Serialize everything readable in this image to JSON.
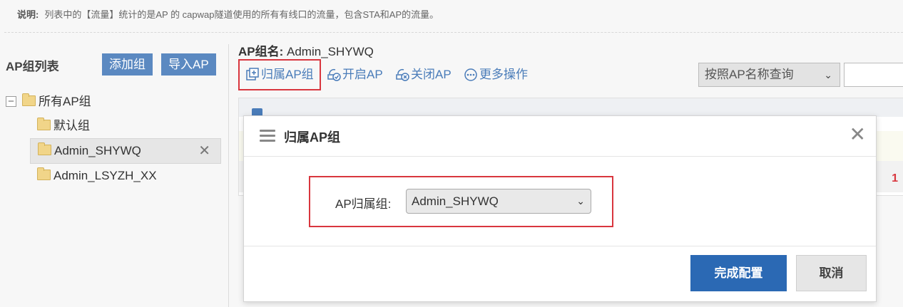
{
  "notice": {
    "label": "说明:",
    "text": "列表中的【流量】统计的是AP 的 capwap隧道使用的所有有线口的流量，包含STA和AP的流量。"
  },
  "left_panel": {
    "title": "AP组列表",
    "add_group_label": "添加组",
    "import_ap_label": "导入AP",
    "tree": {
      "root": "所有AP组",
      "children": [
        "默认组",
        "Admin_SHYWQ",
        "Admin_LSYZH_XX"
      ]
    }
  },
  "right_panel": {
    "title_label": "AP组名:",
    "title_value": "Admin_SHYWQ",
    "toolbar": {
      "assign_group": "归属AP组",
      "enable_ap": "开启AP",
      "disable_ap": "关闭AP",
      "more_ops": "更多操作"
    },
    "query_select": "按照AP名称查询",
    "row_number": "1"
  },
  "modal": {
    "title": "归属AP组",
    "field_label": "AP归属组:",
    "field_value": "Admin_SHYWQ",
    "confirm_label": "完成配置",
    "cancel_label": "取消"
  },
  "colors": {
    "primary": "#2b69b4",
    "link": "#4a7cb9",
    "highlight_border": "#d9363e"
  }
}
